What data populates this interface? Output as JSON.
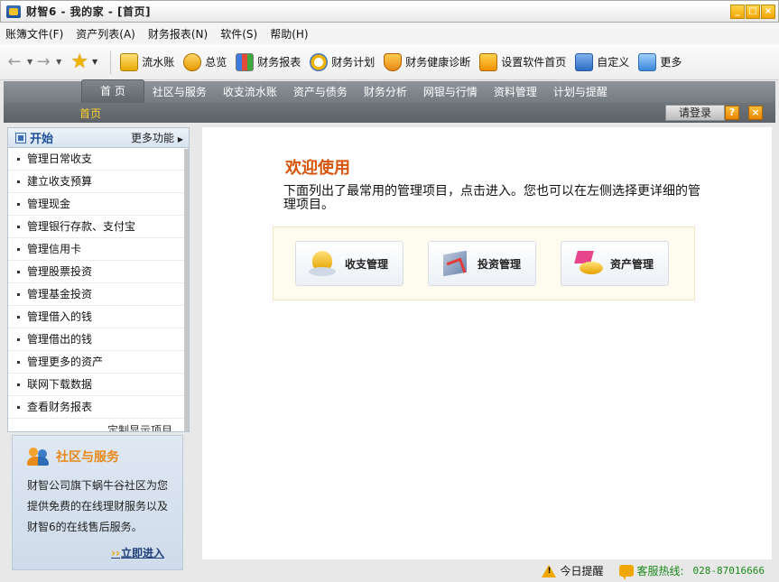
{
  "window": {
    "title": "财智6 - 我的家 - [首页]",
    "controls": [
      "_",
      "□",
      "×"
    ]
  },
  "menubar": {
    "items": [
      "账簿文件(F)",
      "资产列表(A)",
      "财务报表(N)",
      "软件(S)",
      "帮助(H)"
    ]
  },
  "toolbar": {
    "icons": {
      "back": "back-arrow-icon",
      "forward": "forward-arrow-icon",
      "favorite": "star-icon"
    },
    "buttons": [
      {
        "label": "流水账",
        "icon": "ledger-icon"
      },
      {
        "label": "总览",
        "icon": "overview-icon"
      },
      {
        "label": "财务报表",
        "icon": "report-chart-icon"
      },
      {
        "label": "财务计划",
        "icon": "plan-clock-icon"
      },
      {
        "label": "财务健康诊断",
        "icon": "health-shield-icon"
      },
      {
        "label": "设置软件首页",
        "icon": "home-upload-icon"
      },
      {
        "label": "自定义",
        "icon": "customize-icon"
      },
      {
        "label": "更多",
        "icon": "more-icon"
      }
    ]
  },
  "tabs": [
    "首 页",
    "社区与服务",
    "收支流水账",
    "资产与债务",
    "财务分析",
    "网银与行情",
    "资料管理",
    "计划与提醒"
  ],
  "subbar": {
    "title": "首页",
    "login": "请登录",
    "help": "?",
    "close": "×"
  },
  "left_panel": {
    "title": "开始",
    "more": "更多功能",
    "items": [
      "管理日常收支",
      "建立收支预算",
      "管理现金",
      "管理银行存款、支付宝",
      "管理信用卡",
      "管理股票投资",
      "管理基金投资",
      "管理借入的钱",
      "管理借出的钱",
      "管理更多的资产",
      "联网下载数据",
      "查看财务报表"
    ],
    "partial": "定制显示项目"
  },
  "community": {
    "title": "社区与服务",
    "desc": "财智公司旗下蜗牛谷社区为您提供免费的在线理财服务以及财智6的在线售后服务。",
    "link": "立即进入",
    "chevron": "››"
  },
  "main": {
    "welcome_title": "欢迎使用",
    "welcome_desc": "下面列出了最常用的管理项目，点击进入。您也可以在左侧选择更详细的管理项目。",
    "cards": [
      {
        "label": "收支管理",
        "icon": "income-expense-icon"
      },
      {
        "label": "投资管理",
        "icon": "investment-icon"
      },
      {
        "label": "资产管理",
        "icon": "asset-icon"
      }
    ]
  },
  "statusbar": {
    "reminder": "今日提醒",
    "hotline_label": "客服热线:",
    "hotline_number": "028-87016666"
  },
  "colors": {
    "welcome_title": "#d9540a",
    "tab_bar": "#7a8086",
    "sub_title": "#ffd22a",
    "hotline": "#1a8a1a",
    "community_title": "#e8891a"
  }
}
